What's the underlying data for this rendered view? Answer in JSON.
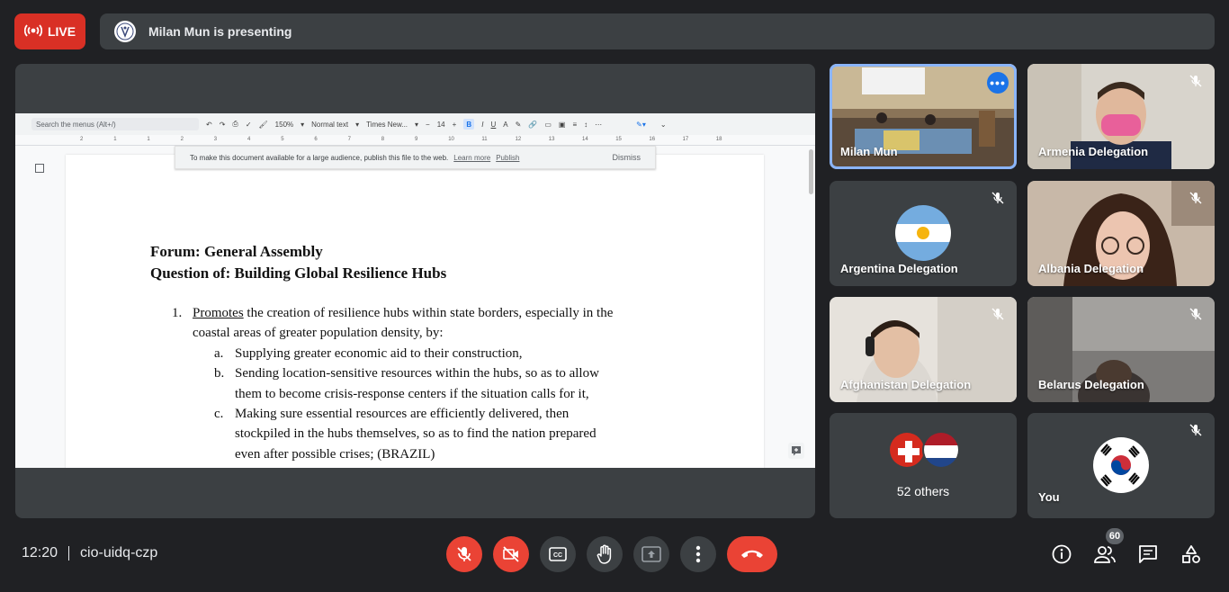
{
  "top_bar": {
    "live_label": "LIVE",
    "presenting_text": "Milan Mun is presenting"
  },
  "document": {
    "toolbar": {
      "search_placeholder": "Search the menus (Alt+/)",
      "zoom": "150%",
      "style": "Normal text",
      "font": "Times New...",
      "font_size": "14"
    },
    "ruler_ticks": [
      "2",
      "1",
      "1",
      "2",
      "3",
      "4",
      "5",
      "6",
      "7",
      "8",
      "9",
      "10",
      "11",
      "12",
      "13",
      "14",
      "15",
      "16",
      "17",
      "18"
    ],
    "banner": {
      "text": "To make this document available for a large audience, publish this file to the web.",
      "learn_more": "Learn more",
      "publish": "Publish",
      "dismiss": "Dismiss"
    },
    "forum_line": "Forum: General Assembly",
    "question_line": "Question of: Building Global Resilience Hubs",
    "clause_1_number": "1.",
    "clause_1_keyword": "Promotes",
    "clause_1_line1_rest": " the creation of resilience hubs within state borders, especially in the",
    "clause_1_line2": "coastal areas of greater population density, by:",
    "sub_a_label": "a.",
    "sub_a_text": "Supplying greater economic aid to their construction,",
    "sub_b_label": "b.",
    "sub_b_line1": "Sending location-sensitive resources within the hubs, so as to allow",
    "sub_b_line2": "them to become crisis-response centers if the situation calls for it,",
    "sub_c_label": "c.",
    "sub_c_line1": "Making sure essential resources are efficiently delivered, then",
    "sub_c_line2": "stockpiled in the hubs themselves, so as to find the nation prepared",
    "sub_c_line3": "even after possible crises; (BRAZIL)"
  },
  "participants": {
    "milan": "Milan Mun",
    "armenia": "Armenia Delegation",
    "argentina": "Argentina Delegation",
    "albania": "Albania Delegation",
    "afghanistan": "Afghanistan Delegation",
    "belarus": "Belarus Delegation",
    "others": "52 others",
    "you": "You"
  },
  "bottom_bar": {
    "time": "12:20",
    "meeting_code": "cio-uidq-czp",
    "participant_count": "60"
  },
  "colors": {
    "background": "#202124",
    "tile": "#3c4043",
    "danger": "#ea4335",
    "accent": "#8ab4f8"
  }
}
